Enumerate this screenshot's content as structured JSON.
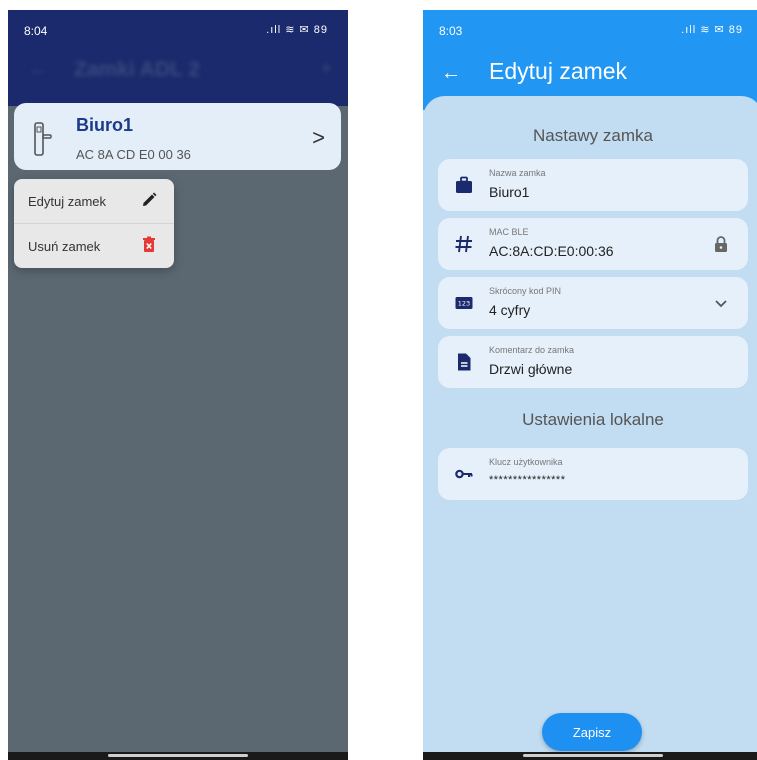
{
  "left_screen": {
    "status_time": "8:04",
    "status_icons": ".ıll ≋ ✉ 89",
    "appbar_title": "Zamki ADL 2",
    "lock": {
      "name": "Biuro1",
      "mac": "AC 8A CD E0 00 36",
      "icon": "door-lock-icon"
    },
    "menu": {
      "items": [
        {
          "label": "Edytuj zamek",
          "icon": "pencil-icon"
        },
        {
          "label": "Usuń zamek",
          "icon": "trash-icon",
          "color": "#e53935"
        }
      ]
    }
  },
  "right_screen": {
    "status_time": "8:03",
    "status_icons": ".ıll ≋ ✉ 89",
    "appbar_title": "Edytuj zamek",
    "section1_title": "Nastawy zamka",
    "fields": [
      {
        "label": "Nazwa zamka",
        "value": "Biuro1",
        "icon": "briefcase-icon"
      },
      {
        "label": "MAC BLE",
        "value": "AC:8A:CD:E0:00:36",
        "icon": "hash-icon",
        "trailing_icon": "lock-icon"
      },
      {
        "label": "Skrócony kod PIN",
        "value": "4 cyfry",
        "icon": "numeric-123-icon",
        "trailing_icon": "chevron-down-icon"
      },
      {
        "label": "Komentarz do zamka",
        "value": "Drzwi główne",
        "icon": "document-icon"
      }
    ],
    "section2_title": "Ustawienia lokalne",
    "user_key": {
      "label": "Klucz użytkownika",
      "value": "****************",
      "icon": "key-icon"
    },
    "save_label": "Zapisz"
  },
  "colors": {
    "left_appbar": "#1a2a6c",
    "right_appbar": "#2196f3",
    "accent": "#1e90f2",
    "delete": "#e53935",
    "lock_name": "#1c3a8a"
  }
}
